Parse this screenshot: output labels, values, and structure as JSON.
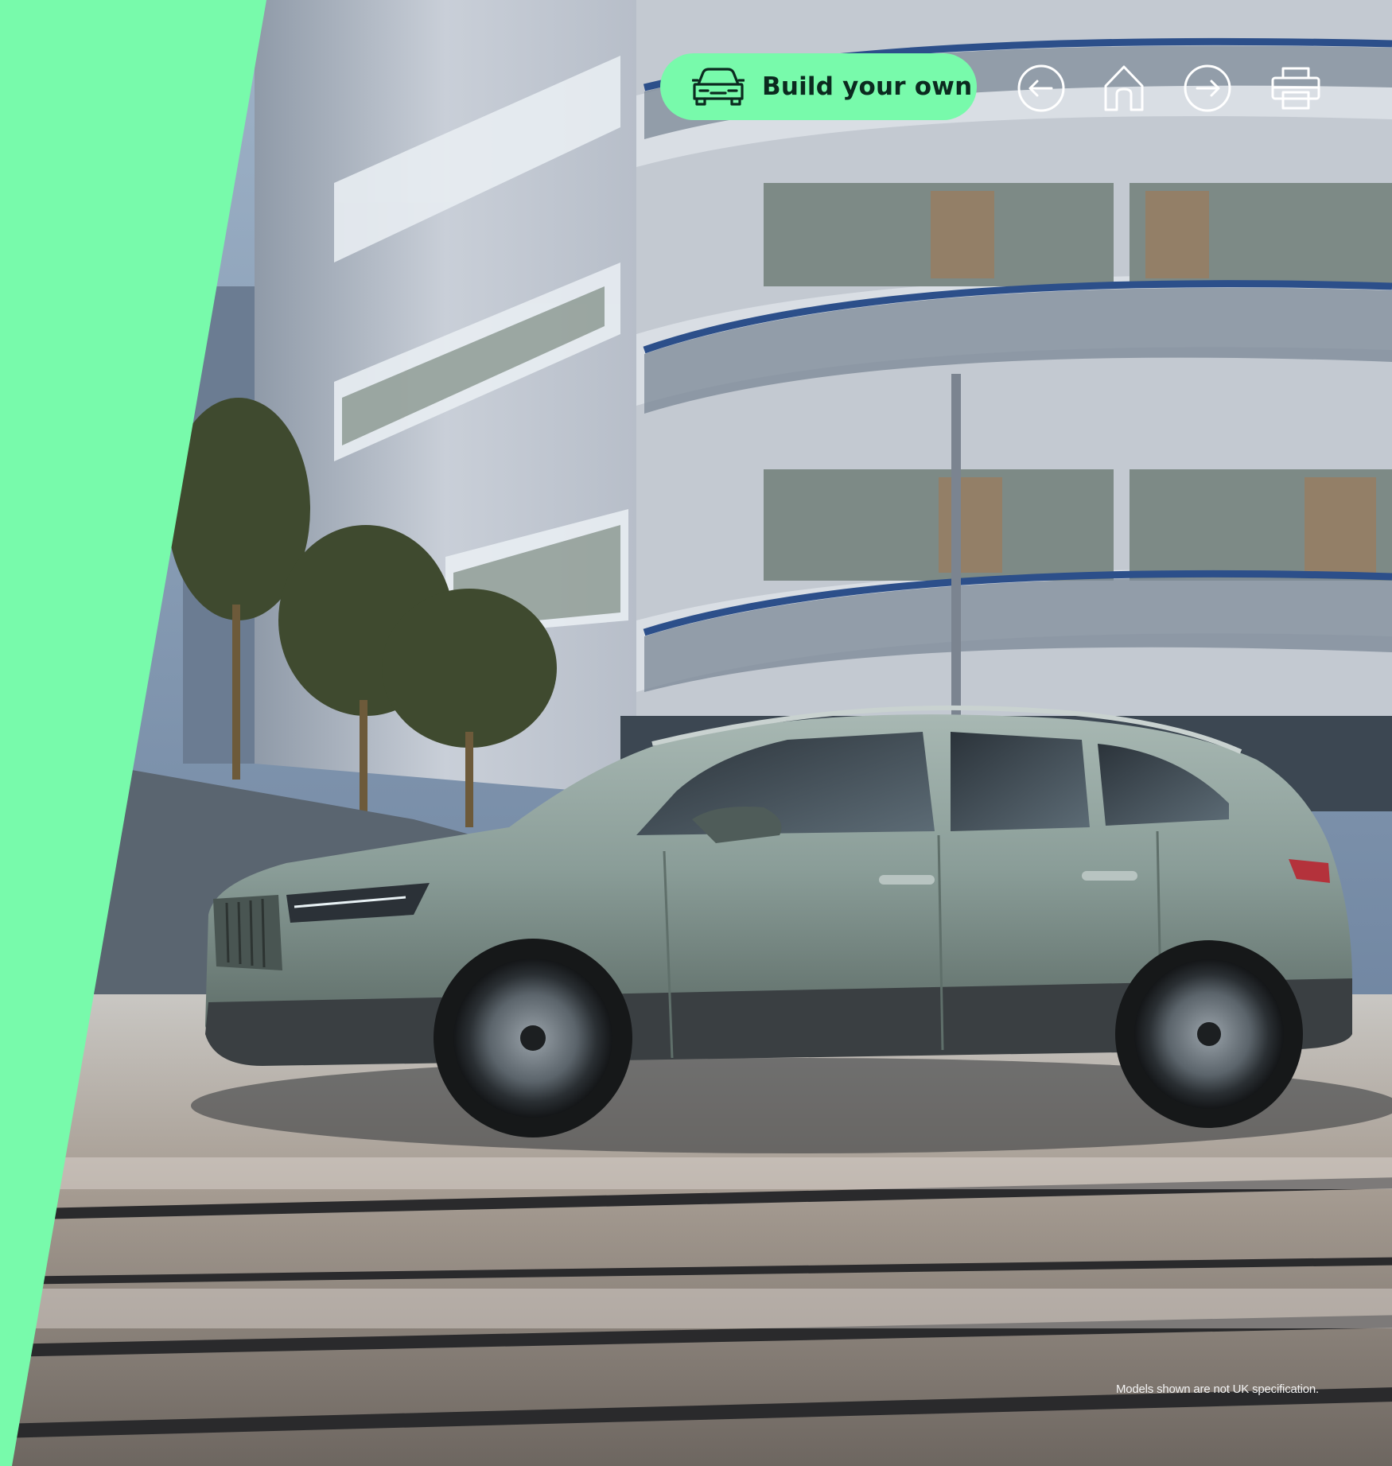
{
  "toolbar": {
    "build_label": "Build your own",
    "build_icon": "car-front-icon",
    "back_icon": "arrow-left-circle-icon",
    "home_icon": "home-icon",
    "forward_icon": "arrow-right-circle-icon",
    "print_icon": "printer-icon"
  },
  "footer": {
    "disclaimer": "Models shown are not UK specification."
  },
  "colors": {
    "accent": "#78faab",
    "button_text": "#0b2a1f",
    "icon_stroke": "#ffffff"
  },
  "image": {
    "subject": "silver-green electric SUV driving on a city street past a curved apartment building with blue balcony railings"
  }
}
